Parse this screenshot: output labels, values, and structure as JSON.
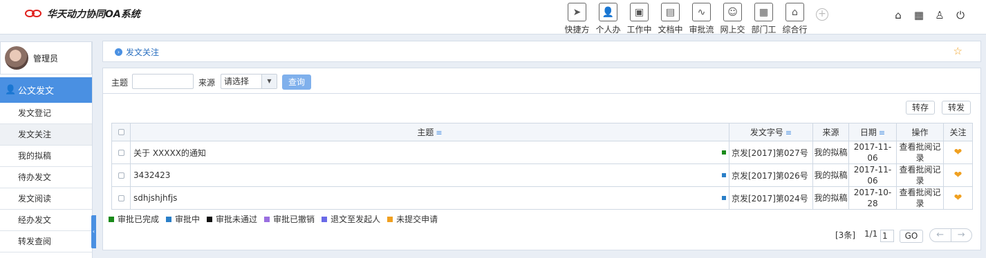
{
  "app": {
    "title": "华天动力协同OA系统",
    "brand_color": "#e0201c"
  },
  "nav": [
    {
      "label": "快捷方",
      "icon": "send-icon",
      "glyph": "➤"
    },
    {
      "label": "个人办",
      "icon": "person-icon",
      "glyph": "👤"
    },
    {
      "label": "工作中",
      "icon": "briefcase-icon",
      "glyph": "▣"
    },
    {
      "label": "文档中",
      "icon": "document-tray-icon",
      "glyph": "▤"
    },
    {
      "label": "审批流",
      "icon": "flow-icon",
      "glyph": "∿"
    },
    {
      "label": "网上交",
      "icon": "chat-icon",
      "glyph": "☺"
    },
    {
      "label": "部门工",
      "icon": "department-icon",
      "glyph": "▦"
    },
    {
      "label": "综合行",
      "icon": "building-icon",
      "glyph": "⌂"
    }
  ],
  "tools": [
    {
      "icon": "home-icon",
      "glyph": "⌂"
    },
    {
      "icon": "grid-icon",
      "glyph": "▦"
    },
    {
      "icon": "shirt-icon",
      "glyph": "♙"
    },
    {
      "icon": "power-icon",
      "glyph": "⏻"
    }
  ],
  "user": {
    "name": "管理员"
  },
  "sidebar": {
    "header": "公文发文",
    "items": [
      {
        "label": "发文登记",
        "active": false
      },
      {
        "label": "发文关注",
        "active": true
      },
      {
        "label": "我的拟稿",
        "active": false
      },
      {
        "label": "待办发文",
        "active": false
      },
      {
        "label": "发文阅读",
        "active": false
      },
      {
        "label": "经办发文",
        "active": false
      },
      {
        "label": "转发查阅",
        "active": false
      }
    ]
  },
  "breadcrumb": {
    "text": "发文关注"
  },
  "filter": {
    "subject_label": "主题",
    "subject_value": "",
    "source_label": "来源",
    "source_value": "请选择",
    "query_label": "查询"
  },
  "actions": {
    "save_label": "转存",
    "forward_label": "转发"
  },
  "table": {
    "headers": {
      "subject": "主题",
      "doc_no": "发文字号",
      "source": "来源",
      "date": "日期",
      "op": "操作",
      "follow": "关注"
    },
    "rows": [
      {
        "subject": "关于 XXXXX的通知",
        "status_color": "#1a8a1a",
        "doc_no": "京发[2017]第027号",
        "source": "我的拟稿",
        "date": "2017-11-06",
        "op": "查看批阅记录"
      },
      {
        "subject": "3432423",
        "status_color": "#2a7fc8",
        "doc_no": "京发[2017]第026号",
        "source": "我的拟稿",
        "date": "2017-11-06",
        "op": "查看批阅记录"
      },
      {
        "subject": "sdhjshjhfjs",
        "status_color": "#2a7fc8",
        "doc_no": "京发[2017]第024号",
        "source": "我的拟稿",
        "date": "2017-10-28",
        "op": "查看批阅记录"
      }
    ]
  },
  "legend": [
    {
      "label": "审批已完成",
      "color": "#1a8a1a"
    },
    {
      "label": "审批中",
      "color": "#2a7fc8"
    },
    {
      "label": "审批未通过",
      "color": "#111111"
    },
    {
      "label": "审批已撤销",
      "color": "#9a6fe0"
    },
    {
      "label": "退文至发起人",
      "color": "#6a6ae8"
    },
    {
      "label": "未提交申请",
      "color": "#f0a020"
    }
  ],
  "pager": {
    "count": "[3条]",
    "page": "1/1",
    "page_input": "1",
    "go_label": "GO"
  }
}
